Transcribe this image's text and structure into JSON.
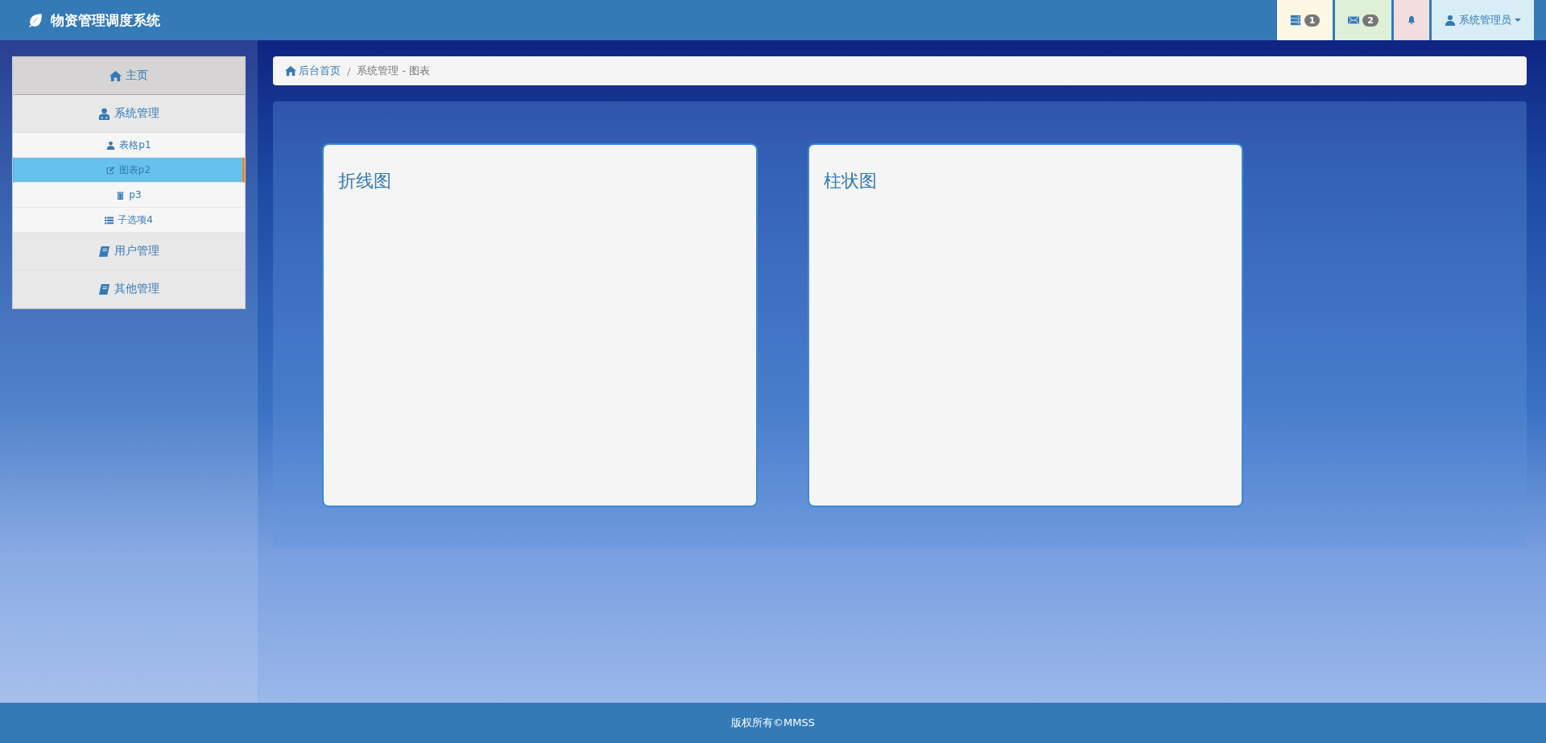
{
  "header": {
    "title": "物资管理调度系统",
    "buttons": [
      {
        "kind": "tasks",
        "badge": "1",
        "color": "#fcf8e3"
      },
      {
        "kind": "messages",
        "badge": "2",
        "color": "#dff0d8"
      },
      {
        "kind": "alerts",
        "color": "#f2dede"
      },
      {
        "kind": "user",
        "label": "系统管理员",
        "color": "#d9edf7"
      }
    ]
  },
  "sidebar": {
    "items": [
      {
        "label": "主页",
        "kind": "home",
        "selected": false,
        "active": true
      },
      {
        "label": "系统管理",
        "kind": "system",
        "selected": false,
        "active": false,
        "expanded": true,
        "children": [
          {
            "label": "表格p1",
            "kind": "table",
            "selected": false
          },
          {
            "label": "图表p2",
            "kind": "chart",
            "selected": true
          },
          {
            "label": "p3",
            "kind": "page",
            "selected": false
          },
          {
            "label": "子选项4",
            "kind": "option",
            "selected": false
          }
        ]
      },
      {
        "label": "用户管理",
        "kind": "section",
        "selected": false,
        "active": false
      },
      {
        "label": "其他管理",
        "kind": "section",
        "selected": false,
        "active": false
      }
    ]
  },
  "breadcrumb": {
    "separator": "/",
    "items": [
      {
        "label": "后台首页",
        "link": true
      },
      {
        "label": "系统管理 - 图表",
        "link": false
      }
    ]
  },
  "cards": [
    {
      "title": "折线图"
    },
    {
      "title": "柱状图"
    }
  ],
  "footer": {
    "text": "版权所有©MMSS"
  }
}
